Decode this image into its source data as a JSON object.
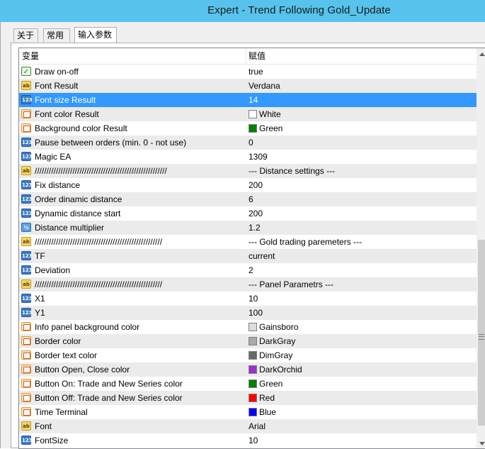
{
  "window": {
    "title": "Expert - Trend Following Gold_Update"
  },
  "tabs": [
    {
      "label": "关于"
    },
    {
      "label": "常用"
    },
    {
      "label": "输入参数"
    }
  ],
  "grid": {
    "col_variable": "变量",
    "col_value": "赋值",
    "rows": [
      {
        "type": "bool",
        "name": "Draw on-off",
        "value": "true"
      },
      {
        "type": "str",
        "name": "Font Result",
        "value": "Verdana"
      },
      {
        "type": "num",
        "name": "Font size Result",
        "value": "14",
        "selected": true
      },
      {
        "type": "color",
        "name": "Font color Result",
        "value": "White",
        "swatch": "#ffffff"
      },
      {
        "type": "color",
        "name": "Background color Result",
        "value": "Green",
        "swatch": "#008000"
      },
      {
        "type": "num",
        "name": "Pause between orders (min. 0 - not use)",
        "value": "0"
      },
      {
        "type": "num",
        "name": "Magic EA",
        "value": "1309"
      },
      {
        "type": "str",
        "name": "////////////////////////////////////////////////////////",
        "value": "--- Distance settings ---"
      },
      {
        "type": "num",
        "name": "Fix distance",
        "value": "200"
      },
      {
        "type": "num",
        "name": "Order dinamic distance",
        "value": "6"
      },
      {
        "type": "num",
        "name": "Dynamic distance start",
        "value": "200"
      },
      {
        "type": "dbl",
        "name": "Distance multiplier",
        "value": "1.2"
      },
      {
        "type": "str",
        "name": "//////////////////////////////////////////////////////",
        "value": "--- Gold trading paremeters ---"
      },
      {
        "type": "num",
        "name": "TF",
        "value": "current"
      },
      {
        "type": "num",
        "name": "Deviation",
        "value": "2"
      },
      {
        "type": "str",
        "name": "//////////////////////////////////////////////////////",
        "value": "--- Panel Parametrs ---"
      },
      {
        "type": "num",
        "name": "X1",
        "value": "10"
      },
      {
        "type": "num",
        "name": "Y1",
        "value": "100"
      },
      {
        "type": "color",
        "name": "Info panel background color",
        "value": "Gainsboro",
        "swatch": "#dcdcdc"
      },
      {
        "type": "color",
        "name": "Border color",
        "value": "DarkGray",
        "swatch": "#a9a9a9"
      },
      {
        "type": "color",
        "name": "Border text color",
        "value": "DimGray",
        "swatch": "#696969"
      },
      {
        "type": "color",
        "name": "Button Open, Close color",
        "value": "DarkOrchid",
        "swatch": "#9932cc"
      },
      {
        "type": "color",
        "name": "Button On: Trade and New Series color",
        "value": "Green",
        "swatch": "#008000"
      },
      {
        "type": "color",
        "name": "Button Off: Trade and New Series color",
        "value": "Red",
        "swatch": "#ff0000"
      },
      {
        "type": "color",
        "name": "Time Terminal",
        "value": "Blue",
        "swatch": "#0000ff"
      },
      {
        "type": "str",
        "name": "Font",
        "value": "Arial"
      },
      {
        "type": "num",
        "name": "FontSize",
        "value": "10"
      }
    ]
  },
  "icons": {
    "bool": "bool-type-icon",
    "str": "string-type-icon",
    "num": "integer-type-icon",
    "dbl": "double-type-icon",
    "color": "color-type-icon"
  },
  "colors": {
    "titlebar": "#57c3ec",
    "selection": "#3399ff"
  }
}
